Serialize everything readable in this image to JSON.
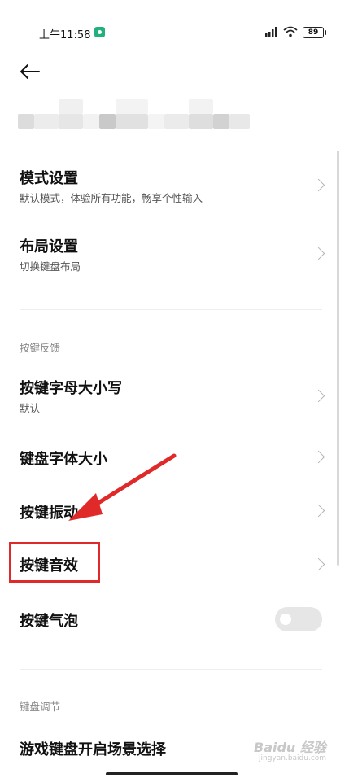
{
  "status": {
    "time": "上午11:58",
    "battery": "89"
  },
  "items": {
    "mode": {
      "title": "模式设置",
      "sub": "默认模式，体验所有功能，畅享个性输入"
    },
    "layout": {
      "title": "布局设置",
      "sub": "切换键盘布局"
    },
    "section_feedback": "按键反馈",
    "case": {
      "title": "按键字母大小写",
      "sub": "默认"
    },
    "font": {
      "title": "键盘字体大小"
    },
    "vibe": {
      "title": "按键振动"
    },
    "sound": {
      "title": "按键音效"
    },
    "bubble": {
      "title": "按键气泡",
      "toggle_on": false
    },
    "section_adjust": "键盘调节",
    "game": {
      "title": "游戏键盘开启场景选择"
    }
  },
  "watermark": {
    "main": "Baidu 经验",
    "sub": "jingyan.baidu.com"
  },
  "colors": {
    "accent": "#e02a2a",
    "toggle_off": "#e6e6e6"
  }
}
